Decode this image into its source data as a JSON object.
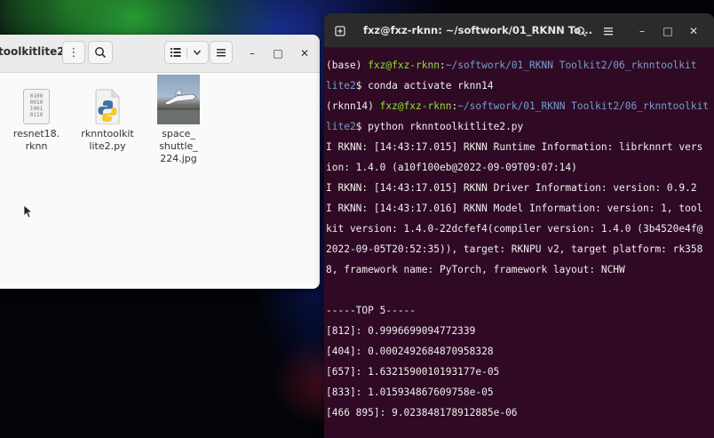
{
  "files_window": {
    "path_title": "toolkitlite2",
    "files": [
      {
        "name": "resnet18.\nrknn",
        "icon": "binary-file-icon"
      },
      {
        "name": "rknntoolkit\nlite2.py",
        "icon": "python-file-icon"
      },
      {
        "name": "space_\nshuttle_\n224.jpg",
        "icon": "image-thumbnail"
      }
    ],
    "buttons": {
      "menu": "⋮",
      "search": "search-icon",
      "view_list": "list-view-icon",
      "view_dropdown": "chevron-down-icon",
      "hamburger": "menu-icon",
      "minimize": "–",
      "maximize": "□",
      "close": "✕"
    }
  },
  "terminal": {
    "title": "fxz@fxz-rknn: ~/softwork/01_RKNN To...",
    "lines": [
      {
        "prefix": "(base) ",
        "user": "fxz@fxz-rknn",
        "sep": ":",
        "path": "~/softwork/01_RKNN Toolkit2/06_rknntoolkit",
        "rest": ""
      },
      {
        "prefix": "",
        "user": "",
        "sep": "",
        "path": "lite2",
        "rest": "$ conda activate rknn14"
      },
      {
        "prefix": "(rknn14) ",
        "user": "fxz@fxz-rknn",
        "sep": ":",
        "path": "~/softwork/01_RKNN Toolkit2/06_rknntoolkit",
        "rest": ""
      },
      {
        "prefix": "",
        "user": "",
        "sep": "",
        "path": "lite2",
        "rest": "$ python rknntoolkitlite2.py"
      },
      {
        "prefix": "I RKNN: [14:43:17.015] RKNN Runtime Information: librknnrt vers",
        "user": "",
        "sep": "",
        "path": "",
        "rest": ""
      },
      {
        "prefix": "ion: 1.4.0 (a10f100eb@2022-09-09T09:07:14)",
        "user": "",
        "sep": "",
        "path": "",
        "rest": ""
      },
      {
        "prefix": "I RKNN: [14:43:17.015] RKNN Driver Information: version: 0.9.2",
        "user": "",
        "sep": "",
        "path": "",
        "rest": ""
      },
      {
        "prefix": "I RKNN: [14:43:17.016] RKNN Model Information: version: 1, tool",
        "user": "",
        "sep": "",
        "path": "",
        "rest": ""
      },
      {
        "prefix": "kit version: 1.4.0-22dcfef4(compiler version: 1.4.0 (3b4520e4f@",
        "user": "",
        "sep": "",
        "path": "",
        "rest": ""
      },
      {
        "prefix": "2022-09-05T20:52:35)), target: RKNPU v2, target platform: rk358",
        "user": "",
        "sep": "",
        "path": "",
        "rest": ""
      },
      {
        "prefix": "8, framework name: PyTorch, framework layout: NCHW",
        "user": "",
        "sep": "",
        "path": "",
        "rest": ""
      },
      {
        "prefix": "",
        "user": "",
        "sep": "",
        "path": "",
        "rest": ""
      },
      {
        "prefix": "-----TOP 5-----",
        "user": "",
        "sep": "",
        "path": "",
        "rest": ""
      },
      {
        "prefix": "[812]: 0.9996699094772339",
        "user": "",
        "sep": "",
        "path": "",
        "rest": ""
      },
      {
        "prefix": "[404]: 0.0002492684870958328",
        "user": "",
        "sep": "",
        "path": "",
        "rest": ""
      },
      {
        "prefix": "[657]: 1.6321590010193177e-05",
        "user": "",
        "sep": "",
        "path": "",
        "rest": ""
      },
      {
        "prefix": "[833]: 1.015934867609758e-05",
        "user": "",
        "sep": "",
        "path": "",
        "rest": ""
      },
      {
        "prefix": "[466 895]: 9.023848178912885e-06",
        "user": "",
        "sep": "",
        "path": "",
        "rest": ""
      }
    ],
    "colors": {
      "background": "#300a24",
      "user": "#8ae234",
      "path": "#729fcf",
      "text": "#eeeeee"
    }
  }
}
